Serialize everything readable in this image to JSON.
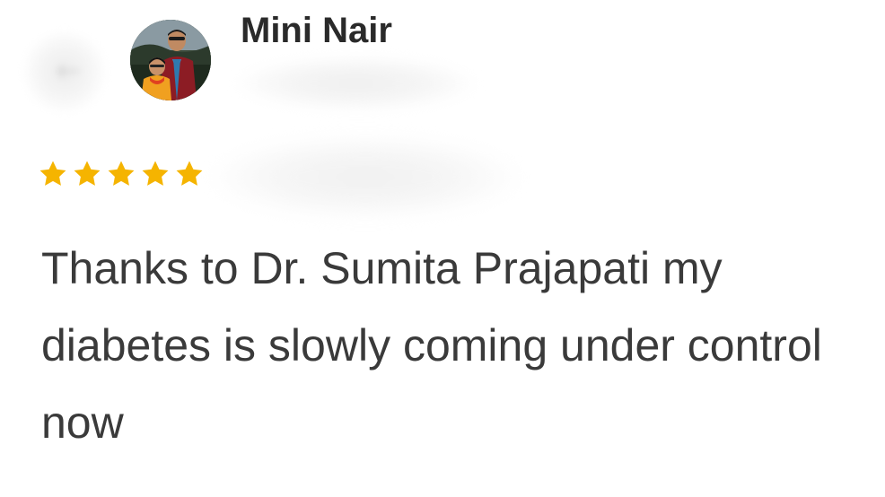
{
  "review": {
    "reviewer_name": "Mini Nair",
    "rating": 5,
    "max_rating": 5,
    "star_color": "#F5B400",
    "text": "Thanks to Dr. Sumita Prajapati my diabetes is slowly coming under control now"
  },
  "icons": {
    "back": "back-arrow-icon",
    "star": "star-icon"
  }
}
